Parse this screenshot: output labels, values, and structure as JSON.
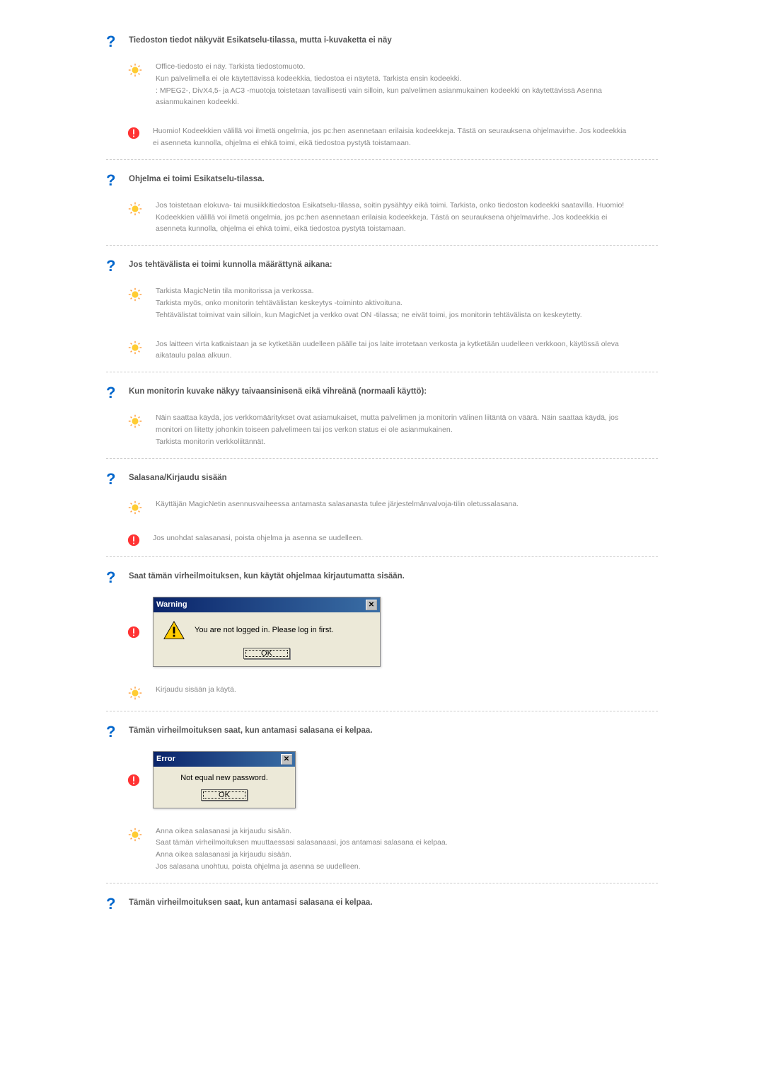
{
  "sections": [
    {
      "title": "Tiedoston tiedot näkyvät Esikatselu-tilassa, mutta i-kuvaketta ei näy",
      "entries": [
        {
          "type": "tip",
          "text": "Office-tiedosto ei näy. Tarkista tiedostomuoto.\nKun palvelimella ei ole käytettävissä kodeekkia, tiedostoa ei näytetä. Tarkista ensin kodeekki.\n: MPEG2-, DivX4,5- ja AC3 -muotoja toistetaan tavallisesti vain silloin, kun palvelimen asianmukainen kodeekki on käytettävissä  Asenna asianmukainen kodeekki."
        },
        {
          "type": "alert",
          "text": "Huomio! Kodeekkien välillä voi ilmetä ongelmia, jos pc:hen asennetaan erilaisia kodeekkeja. Tästä on seurauksena ohjelmavirhe. Jos kodeekkia ei asenneta kunnolla, ohjelma ei ehkä toimi, eikä tiedostoa pystytä toistamaan."
        }
      ]
    },
    {
      "title": "Ohjelma ei toimi Esikatselu-tilassa.",
      "entries": [
        {
          "type": "tip",
          "text": "Jos toistetaan elokuva- tai musiikkitiedostoa Esikatselu-tilassa, soitin pysähtyy eikä toimi. Tarkista, onko tiedoston kodeekki saatavilla. Huomio! Kodeekkien välillä voi ilmetä ongelmia, jos pc:hen asennetaan erilaisia kodeekkeja. Tästä on seurauksena ohjelmavirhe. Jos kodeekkia ei asenneta kunnolla, ohjelma ei ehkä toimi, eikä tiedostoa pystytä toistamaan."
        }
      ]
    },
    {
      "title": "Jos tehtävälista ei toimi kunnolla määrättynä aikana:",
      "entries": [
        {
          "type": "tip",
          "text": "Tarkista MagicNetin tila monitorissa ja verkossa.\nTarkista myös, onko monitorin tehtävälistan keskeytys -toiminto aktivoituna.\nTehtävälistat toimivat vain silloin, kun MagicNet ja verkko ovat ON -tilassa; ne eivät toimi, jos monitorin tehtävälista on keskeytetty."
        },
        {
          "type": "tip",
          "text": "Jos laitteen virta katkaistaan ja se kytketään uudelleen päälle tai jos laite irrotetaan verkosta ja kytketään uudelleen verkkoon, käytössä oleva aikataulu palaa alkuun."
        }
      ]
    },
    {
      "title": "Kun monitorin kuvake näkyy taivaansinisenä eikä vihreänä (normaali käyttö):",
      "entries": [
        {
          "type": "tip",
          "text": "Näin saattaa käydä, jos verkkomääritykset ovat asiamukaiset, mutta palvelimen ja monitorin välinen liitäntä on väärä. Näin saattaa käydä, jos monitori on liitetty johonkin toiseen palvelimeen tai jos verkon status ei ole asianmukainen.\nTarkista monitorin verkkoliitännät."
        }
      ]
    },
    {
      "title": "Salasana/Kirjaudu sisään",
      "entries": [
        {
          "type": "tip",
          "text": "Käyttäjän MagicNetin asennusvaiheessa antamasta salasanasta tulee järjestelmänvalvoja-tilin oletussalasana."
        },
        {
          "type": "alert",
          "text": "Jos unohdat salasanasi, poista ohjelma ja asenna se uudelleen."
        }
      ]
    },
    {
      "title": "Saat tämän virheilmoituksen, kun käytät ohjelmaa kirjautumatta sisään.",
      "dialog": {
        "title": "Warning",
        "message": "You are not logged in. Please log in first.",
        "ok": "OK",
        "showWarnIcon": true
      },
      "entries": [
        {
          "type": "tip",
          "text": "Kirjaudu sisään ja käytä."
        }
      ]
    },
    {
      "title": "Tämän virheilmoituksen saat, kun antamasi salasana ei kelpaa.",
      "dialog": {
        "title": "Error",
        "message": "Not equal new password.",
        "ok": "OK",
        "showWarnIcon": false,
        "small": true
      },
      "entries": [
        {
          "type": "tip",
          "text": "Anna oikea salasanasi ja kirjaudu sisään.\nSaat tämän virheilmoituksen muuttaessasi salasanaasi, jos antamasi salasana ei kelpaa.\nAnna oikea salasanasi ja kirjaudu sisään.\nJos salasana unohtuu, poista ohjelma ja asenna se uudelleen."
        }
      ]
    },
    {
      "title": "Tämän virheilmoituksen saat, kun antamasi salasana ei kelpaa.",
      "entries": []
    }
  ]
}
